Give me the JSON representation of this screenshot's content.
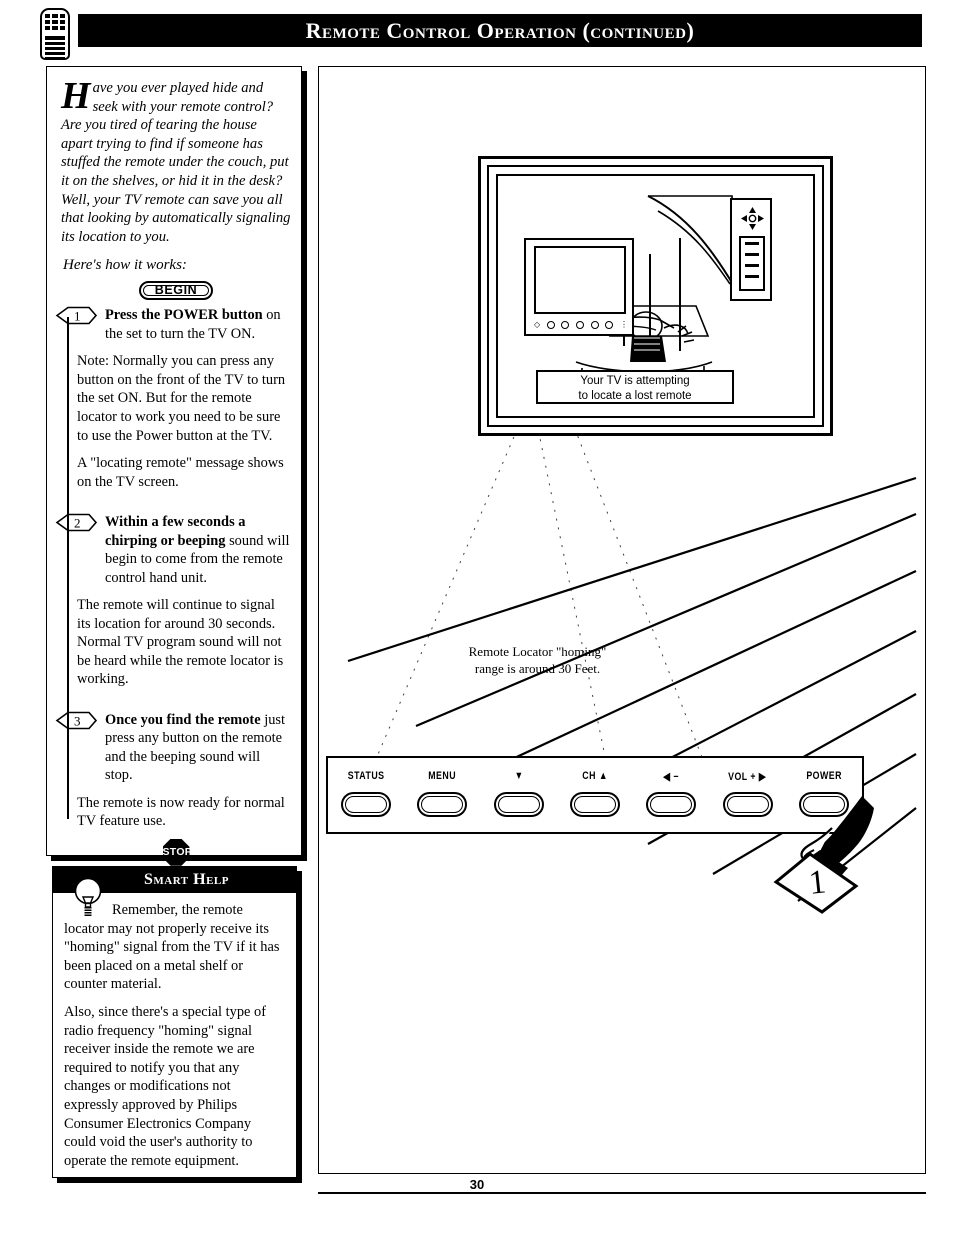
{
  "header": {
    "title": "Remote Control Operation (continued)",
    "icon": "remote-control-icon"
  },
  "intro": {
    "dropcap": "H",
    "text": "ave you ever played hide and seek with your remote control? Are you tired of tearing the house apart trying to find if someone has stuffed the remote under the couch, put it on the shelves, or hid it in the desk? Well, your TV remote can save you all that looking by automatically signaling its location to you.",
    "lead_in": "Here's how it works:",
    "begin_badge": "BEGIN"
  },
  "steps": [
    {
      "number": "1",
      "heading_bold": "Press the POWER button",
      "heading_rest": " on the set to turn the TV ON.",
      "paragraphs": [
        "Note: Normally you can press any button on the front of the TV to turn the set ON. But for the remote locator to work you need to be sure to use the Power button at the TV.",
        "A \"locating remote\" message shows on the TV screen."
      ]
    },
    {
      "number": "2",
      "heading_bold": "Within a few seconds a chirping or beeping",
      "heading_rest": " sound will begin to come from the remote control hand unit.",
      "paragraphs": [
        "The remote will continue to signal its location for around 30 seconds. Normal TV program sound will not be heard while the remote locator is working."
      ]
    },
    {
      "number": "3",
      "heading_bold": "Once you find the remote",
      "heading_rest": " just press any button on the remote and the beeping sound will stop.",
      "paragraphs": [
        "The remote is now ready for normal TV feature use."
      ]
    }
  ],
  "stop_badge": "STOP",
  "smart_help": {
    "title": "Smart Help",
    "icon": "lightbulb-icon",
    "paragraphs": [
      "Remember, the remote locator may not properly receive its \"homing\" signal from the TV if it has been placed on a metal shelf or counter material.",
      "Also, since there's a special type of radio frequency \"homing\" signal receiver inside the remote we are required to notify you that any changes or modifications not expressly approved by Philips Consumer Electronics Company could void the user's authority to operate the remote equipment."
    ]
  },
  "illustration": {
    "tv_screen_message_line1": "Your TV is attempting",
    "tv_screen_message_line2": "to locate a lost remote",
    "locator_caption_line1": "Remote Locator \"homing\"",
    "locator_caption_line2": "range is around 30 Feet.",
    "pointer_label": "1",
    "signal_line_count": 7
  },
  "control_panel": {
    "buttons": [
      {
        "label": "STATUS",
        "name": "status"
      },
      {
        "label": "MENU",
        "name": "menu"
      },
      {
        "label": "▼",
        "name": "channel-down"
      },
      {
        "label": "CH ▲",
        "name": "channel-up"
      },
      {
        "label": "◀ −",
        "name": "volume-down"
      },
      {
        "label": "VOL + ▶",
        "name": "volume-up"
      },
      {
        "label": "POWER",
        "name": "power"
      }
    ]
  },
  "footer": {
    "page_number": "30"
  }
}
